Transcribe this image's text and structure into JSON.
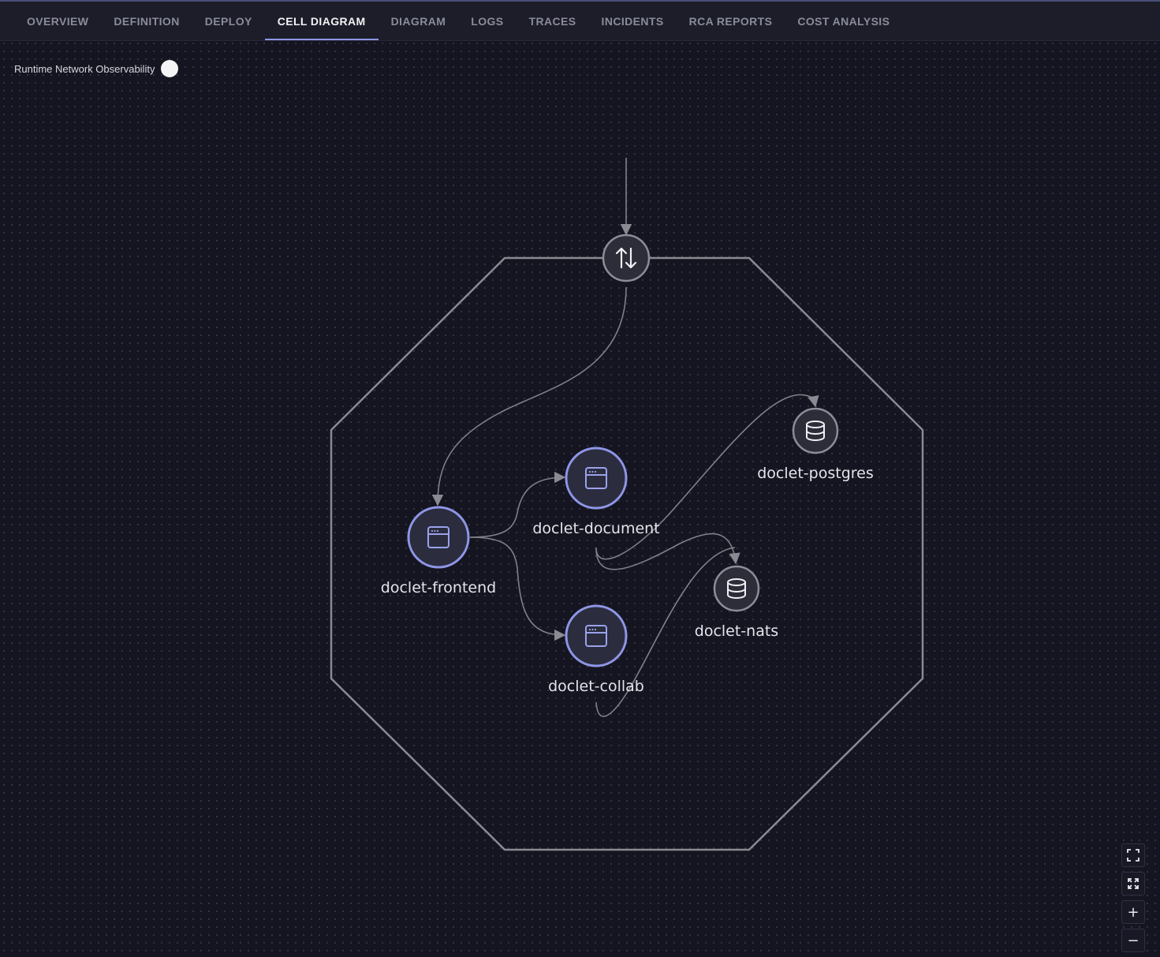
{
  "tabs": [
    {
      "label": "OVERVIEW",
      "active": false
    },
    {
      "label": "DEFINITION",
      "active": false
    },
    {
      "label": "DEPLOY",
      "active": false
    },
    {
      "label": "CELL DIAGRAM",
      "active": true
    },
    {
      "label": "DIAGRAM",
      "active": false
    },
    {
      "label": "LOGS",
      "active": false
    },
    {
      "label": "TRACES",
      "active": false
    },
    {
      "label": "INCIDENTS",
      "active": false
    },
    {
      "label": "RCA REPORTS",
      "active": false
    },
    {
      "label": "COST ANALYSIS",
      "active": false
    }
  ],
  "observability": {
    "label": "Runtime Network Observability",
    "enabled": false
  },
  "nodes": {
    "gateway": {
      "icon": "gateway-arrows-icon"
    },
    "frontend": {
      "label": "doclet-frontend",
      "icon": "browser-window-icon"
    },
    "document": {
      "label": "doclet-document",
      "icon": "browser-window-icon"
    },
    "collab": {
      "label": "doclet-collab",
      "icon": "browser-window-icon"
    },
    "postgres": {
      "label": "doclet-postgres",
      "icon": "database-icon"
    },
    "nats": {
      "label": "doclet-nats",
      "icon": "database-icon"
    }
  },
  "colors": {
    "background": "#151521",
    "component_ring": "#8e96e6",
    "cell_outline": "#8a8a92",
    "active_tab_underline": "#8e96e6"
  },
  "controls": {
    "fit_view": "fit-view-icon",
    "fullscreen": "fullscreen-icon",
    "zoom_in": "+",
    "zoom_out": "−"
  }
}
